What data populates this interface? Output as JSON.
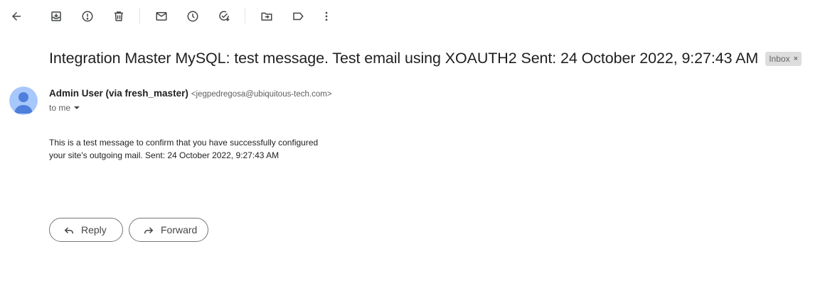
{
  "toolbar": {
    "icons": [
      "back-arrow-icon",
      "archive-icon",
      "report-spam-icon",
      "delete-icon",
      "mark-unread-icon",
      "snooze-icon",
      "add-to-tasks-icon",
      "move-to-icon",
      "label-icon",
      "more-vert-icon"
    ]
  },
  "email": {
    "subject": "Integration Master MySQL: test message. Test email using XOAUTH2 Sent: 24 October 2022, 9:27:43 AM",
    "label": "Inbox",
    "label_close": "×",
    "sender_name": "Admin User (via fresh_master)",
    "sender_email": "<jegpedregosa@ubiquitous-tech.com>",
    "to_text": "to me",
    "body_line1": "This is a test message to confirm that you have successfully configured",
    "body_line2": "your site's outgoing mail. Sent: 24 October 2022, 9:27:43 AM"
  },
  "actions": {
    "reply_label": "Reply",
    "forward_label": "Forward"
  },
  "colors": {
    "avatar_bg": "#a8c7fa",
    "avatar_fg": "#4e7fdc",
    "label_bg": "#dddddd"
  }
}
